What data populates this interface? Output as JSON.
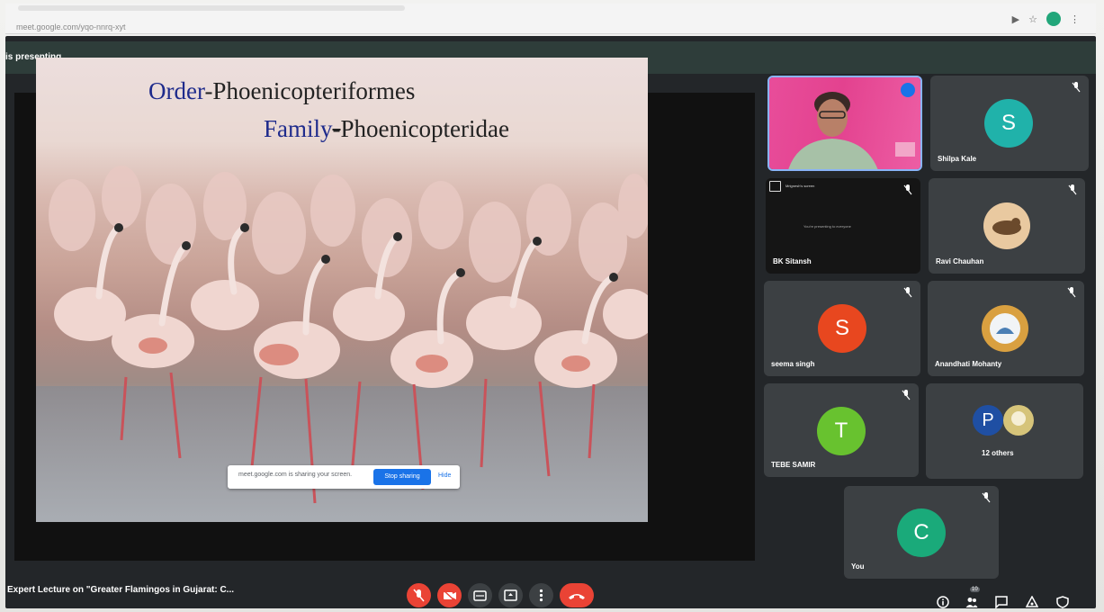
{
  "browser": {
    "url": "meet.google.com/yqo-nnrq-xyt",
    "colors": {
      "profile": "#22a67a"
    }
  },
  "presenting_banner": "is presenting",
  "slide": {
    "order_label": "Order",
    "order_value": "-Phoenicopteriformes",
    "family_label": "Family",
    "family_dash": "-",
    "family_value": "Phoenicopteridae"
  },
  "sharing_bar": {
    "message": "meet.google.com is sharing your screen.",
    "stop_label": "Stop sharing",
    "hide_label": "Hide"
  },
  "participants": [
    {
      "name": "",
      "type": "video",
      "speaking": true
    },
    {
      "name": "Shilpa Kale",
      "initial": "S",
      "color": "#20b2aa"
    },
    {
      "name": "BK Sitansh",
      "type": "presenting",
      "chip": "Mrignesh's screen",
      "subtext": "You're presenting to everyone"
    },
    {
      "name": "Ravi Chauhan",
      "type": "photo"
    },
    {
      "name": "seema singh",
      "initial": "S",
      "color": "#e8471f"
    },
    {
      "name": "Anandhati Mohanty",
      "type": "photo"
    },
    {
      "name": "TEBE SAMIR",
      "initial": "T",
      "color": "#68c22f"
    },
    {
      "name": "12 others",
      "type": "others",
      "initial": "P"
    },
    {
      "name": "You",
      "initial": "C",
      "color": "#1aaa7a"
    }
  ],
  "meeting": {
    "title": "Expert Lecture on \"Greater Flamingos in Gujarat: C...",
    "others_badge": "10"
  },
  "controls": {
    "colors": {
      "red": "#ea4335",
      "grey": "#3c4043",
      "bar": "#2e3d3a"
    }
  }
}
